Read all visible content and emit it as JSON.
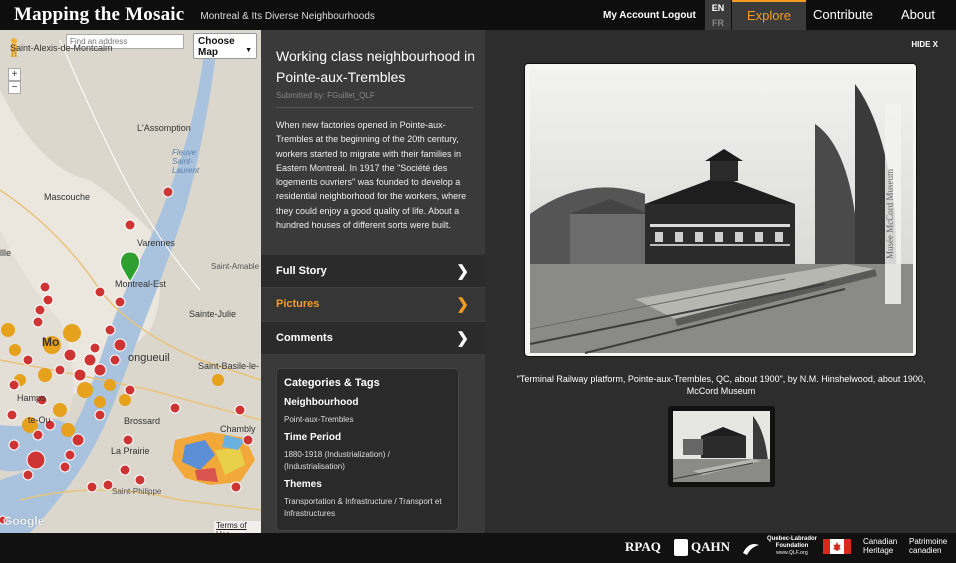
{
  "header": {
    "brand": "Mapping the Mosaic",
    "tagline": "Montreal & Its Diverse Neighbourhoods",
    "my_account": "My Account",
    "logout": "Logout",
    "lang_en": "EN",
    "lang_fr": "FR",
    "nav": {
      "explore": "Explore",
      "contribute": "Contribute",
      "about": "About"
    },
    "accent_color": "#f39c1f"
  },
  "map": {
    "search_placeholder": "Find an address",
    "choose_map": "Choose Map",
    "zoom_in": "+",
    "zoom_out": "−",
    "places": {
      "st_alexis": "Saint-Alexis-de-Montcalm",
      "lassomption": "L'Assomption",
      "fleuve": "Fleuve Saint-Laurent",
      "mascouche": "Mascouche",
      "varennes": "Varennes",
      "saint_amable": "Saint-Amable",
      "montreal_est": "Montreal-Est",
      "sainte_julie": "Sainte-Julie",
      "longueuil": "ongueuil",
      "st_basile": "Saint-Basile-le-",
      "brossard": "Brossard",
      "chambly": "Chambly",
      "la_prairie": "La Prairie",
      "st_philippe": "Saint-Philippe",
      "lle": "llle",
      "mo": "Mo",
      "hamps": "Hamps",
      "te_ou": "te-Ou"
    },
    "google": "Google",
    "terms": "Terms of Use"
  },
  "story": {
    "title": "Working class neighbourhood in Pointe-aux-Trembles",
    "submitted_by": "Submitted by: FGuillet_QLF",
    "description": "When new factories opened in Pointe-aux-Trembles at the beginning of the 20th century, workers started to migrate with their families in Eastern Montreal. In 1917 the \"Société des logements ouvriers\" was founded to develop a residential neighborhood for the workers, where they could enjoy a good quality of life. About a hundred houses of different sorts were built.",
    "sections": {
      "full_story": "Full Story",
      "pictures": "Pictures",
      "comments": "Comments"
    }
  },
  "categories": {
    "heading": "Categories & Tags",
    "neighbourhood_label": "Neighbourhood",
    "neighbourhood_value": "Point-aux-Trembles",
    "period_label": "Time Period",
    "period_value": "1880-1918 (Industrialization) / (Industrialisation)",
    "themes_label": "Themes",
    "themes_value": "Transportation & Infrastructure / Transport et Infrastructures"
  },
  "viewer": {
    "hide": "HIDE X",
    "photo_watermark": "Musée McCord Museum",
    "caption": "\"Terminal Railway platform, Pointe-aux-Trembles, QC, about 1900\", by N.M. Hinshelwood, about 1900, McCord Museum"
  },
  "footer": {
    "rpaq": "RPAQ",
    "qahn": "QAHN",
    "qlf": "Quebec-Labrador Foundation",
    "qlf_url": "www.QLF.org",
    "canadian_heritage": "Canadian Heritage",
    "patrimoine": "Patrimoine canadien"
  }
}
